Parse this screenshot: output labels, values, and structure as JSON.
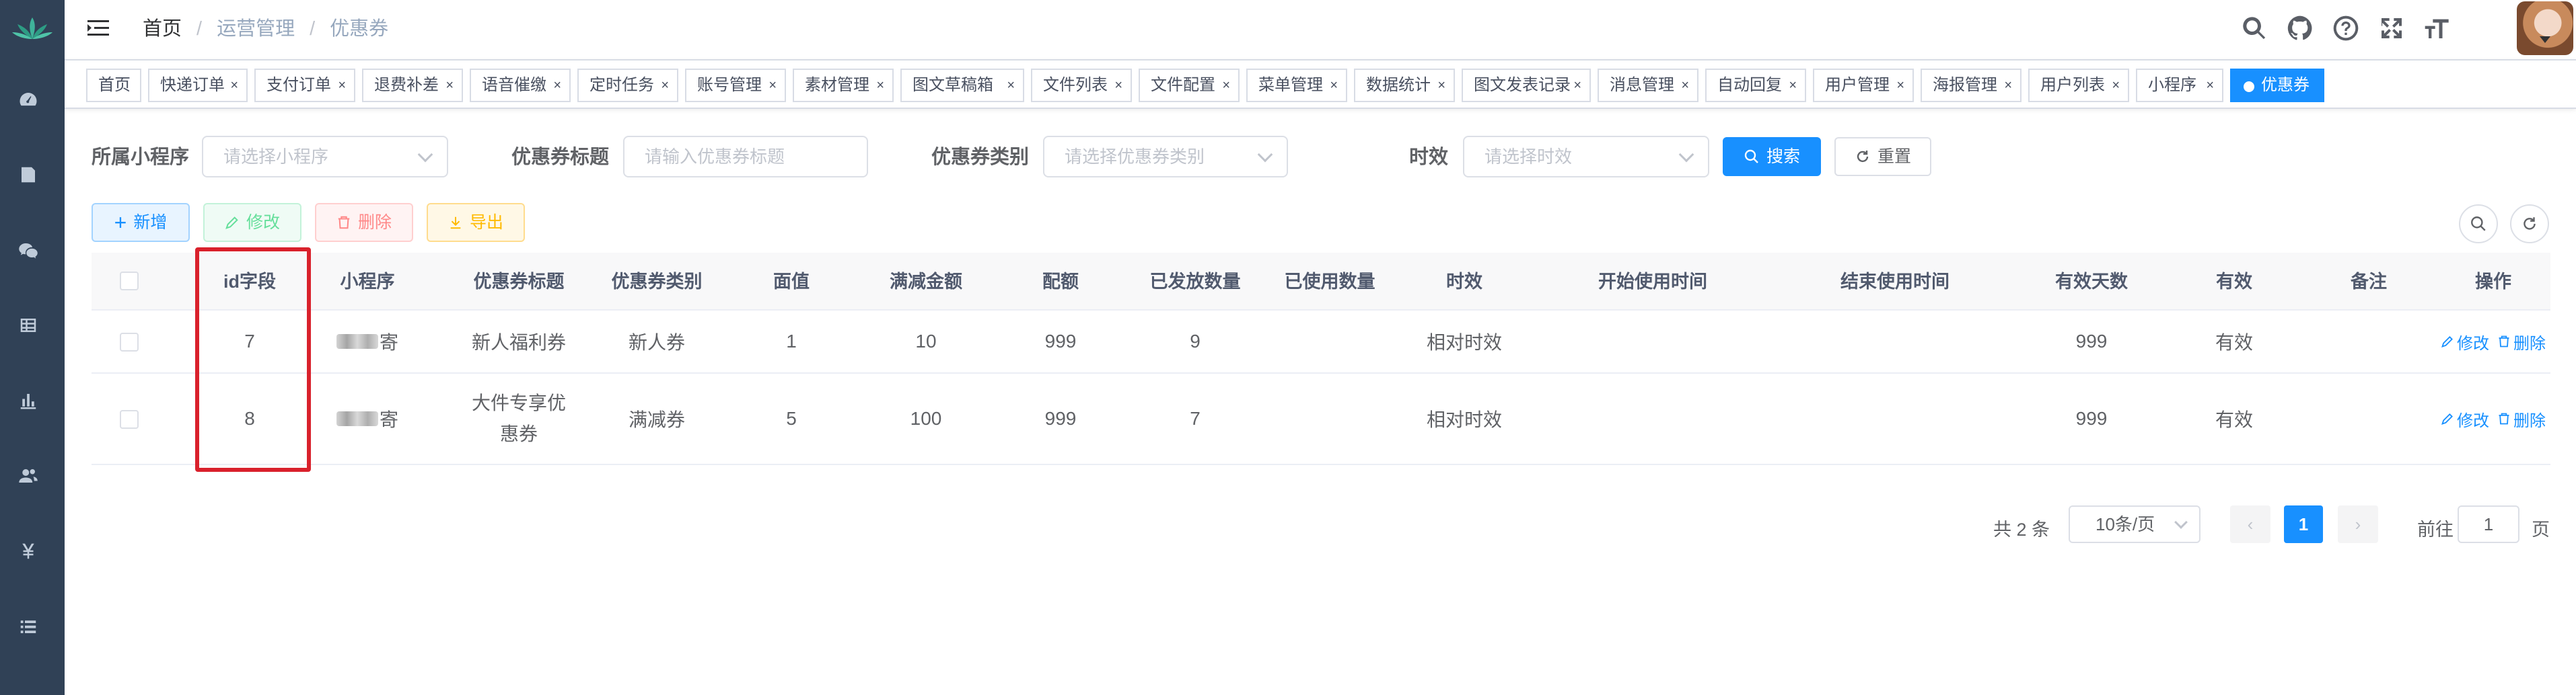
{
  "breadcrumb": [
    "首页",
    "运营管理",
    "优惠券"
  ],
  "sidebar_icons": [
    "dashboard-icon",
    "document-icon",
    "wechat-icon",
    "grid-icon",
    "chart-icon",
    "users-icon",
    "yen-icon",
    "list-icon"
  ],
  "tags": [
    {
      "label": "首页",
      "closable": false
    },
    {
      "label": "快递订单",
      "closable": true
    },
    {
      "label": "支付订单",
      "closable": true
    },
    {
      "label": "退费补差",
      "closable": true
    },
    {
      "label": "语音催缴",
      "closable": true
    },
    {
      "label": "定时任务",
      "closable": true
    },
    {
      "label": "账号管理",
      "closable": true
    },
    {
      "label": "素材管理",
      "closable": true
    },
    {
      "label": "图文草稿箱",
      "closable": true
    },
    {
      "label": "文件列表",
      "closable": true
    },
    {
      "label": "文件配置",
      "closable": true
    },
    {
      "label": "菜单管理",
      "closable": true
    },
    {
      "label": "数据统计",
      "closable": true
    },
    {
      "label": "图文发表记录",
      "closable": true
    },
    {
      "label": "消息管理",
      "closable": true
    },
    {
      "label": "自动回复",
      "closable": true
    },
    {
      "label": "用户管理",
      "closable": true
    },
    {
      "label": "海报管理",
      "closable": true
    },
    {
      "label": "用户列表",
      "closable": true
    },
    {
      "label": "小程序",
      "closable": true
    },
    {
      "label": "优惠券",
      "closable": false,
      "active": true
    }
  ],
  "search": {
    "miniapp_label": "所属小程序",
    "miniapp_placeholder": "请选择小程序",
    "title_label": "优惠券标题",
    "title_placeholder": "请输入优惠券标题",
    "type_label": "优惠券类别",
    "type_placeholder": "请选择优惠券类别",
    "validity_label": "时效",
    "validity_placeholder": "请选择时效",
    "search_btn": "搜索",
    "reset_btn": "重置"
  },
  "toolbar": {
    "add": "新增",
    "edit": "修改",
    "delete": "删除",
    "export": "导出"
  },
  "table": {
    "columns": [
      "id字段",
      "小程序",
      "优惠券标题",
      "优惠券类别",
      "面值",
      "满减金额",
      "配额",
      "已发放数量",
      "已使用数量",
      "时效",
      "开始使用时间",
      "结束使用时间",
      "有效天数",
      "有效",
      "备注",
      "操作"
    ],
    "rows": [
      {
        "id": "7",
        "miniapp": "寄",
        "title": "新人福利券",
        "type": "新人券",
        "face": "1",
        "threshold": "10",
        "quota": "999",
        "issued": "9",
        "used": "",
        "validity": "相对时效",
        "start": "",
        "end": "",
        "days": "999",
        "valid": "有效",
        "remark": ""
      },
      {
        "id": "8",
        "miniapp": "寄",
        "title": "大件专享优惠券",
        "type": "满减券",
        "face": "5",
        "threshold": "100",
        "quota": "999",
        "issued": "7",
        "used": "",
        "validity": "相对时效",
        "start": "",
        "end": "",
        "days": "999",
        "valid": "有效",
        "remark": ""
      }
    ],
    "row_actions": {
      "edit": "修改",
      "delete": "删除"
    }
  },
  "pagination": {
    "total_text": "共 2 条",
    "page_size": "10条/页",
    "current_page": "1",
    "goto_label": "前往",
    "goto_value": "1",
    "page_unit": "页"
  },
  "colors": {
    "primary": "#1890ff",
    "sidebar": "#304156",
    "highlight": "#d9212c"
  }
}
